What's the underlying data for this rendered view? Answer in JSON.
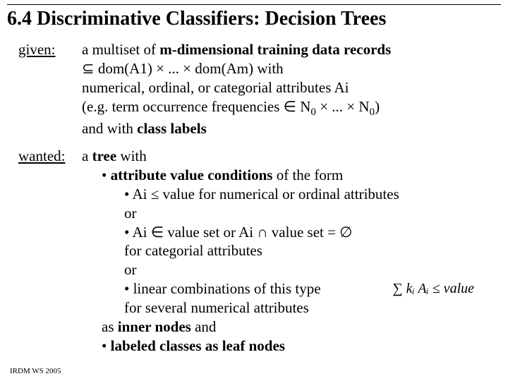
{
  "title": "6.4 Discriminative Classifiers: Decision Trees",
  "given": {
    "label": "given:",
    "l1a": "a multiset of ",
    "l1b": "m-dimensional training data records",
    "l2": "⊆ dom(A1) × ... × dom(Am) with",
    "l3": "numerical, ordinal, or categorial attributes Ai",
    "l4a": "(e.g. term occurrence frequencies ∈ N",
    "l4b": "0",
    "l4c": " × ... × N",
    "l4d": "0",
    "l4e": ")",
    "l5a": "and with ",
    "l5b": "class labels"
  },
  "wanted": {
    "label": "wanted:",
    "l1a": "a ",
    "l1b": "tree",
    "l1c": " with",
    "l2a": "• ",
    "l2b": "attribute value conditions",
    "l2c": " of the form",
    "l3": "• Ai ≤ value for numerical or ordinal attributes",
    "l4": "or",
    "l5": "• Ai ∈ value set or Ai ∩ value set = ∅",
    "l6": "for categorial attributes",
    "l7": "or",
    "l8": "• linear combinations of this type",
    "l9": "for several numerical attributes",
    "l10a": "as ",
    "l10b": "inner nodes",
    "l10c": " and",
    "l11a": "• ",
    "l11b": "labeled classes as leaf nodes",
    "formula": "∑ kᵢ Aᵢ ≤ value"
  },
  "footer": "IRDM  WS 2005"
}
